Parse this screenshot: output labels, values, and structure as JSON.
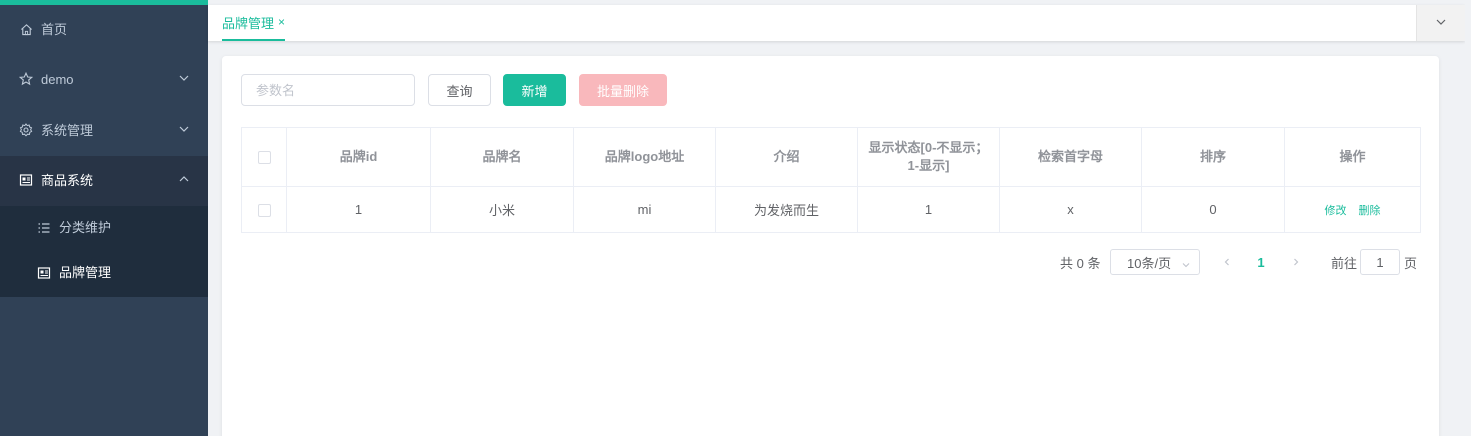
{
  "sidebar": {
    "items": [
      {
        "label": "首页",
        "icon": "home-icon"
      },
      {
        "label": "demo",
        "icon": "star-icon"
      },
      {
        "label": "系统管理",
        "icon": "gear-icon"
      },
      {
        "label": "商品系统",
        "icon": "product-icon"
      }
    ],
    "subitems": [
      {
        "label": "分类维护",
        "icon": "list-icon"
      },
      {
        "label": "品牌管理",
        "icon": "product-icon"
      }
    ]
  },
  "tabs": [
    {
      "label": "品牌管理",
      "close": "×"
    }
  ],
  "toolbar": {
    "search_placeholder": "参数名",
    "query_label": "查询",
    "add_label": "新增",
    "batch_delete_label": "批量删除"
  },
  "table": {
    "columns": [
      "品牌id",
      "品牌名",
      "品牌logo地址",
      "介绍",
      "显示状态[0-不显示；1-显示]",
      "检索首字母",
      "排序",
      "操作"
    ],
    "rows": [
      {
        "id": "1",
        "name": "小米",
        "logo": "mi",
        "intro": "为发烧而生",
        "status": "1",
        "letter": "x",
        "sort": "0",
        "edit": "修改",
        "delete": "删除"
      }
    ]
  },
  "pagination": {
    "total_text": "共 0 条",
    "page_size": "10条/页",
    "current_page": "1",
    "goto_label": "前往",
    "goto_value": "1",
    "goto_suffix": "页"
  },
  "colors": {
    "accent": "#1abc9c",
    "sidebar_bg": "#304156",
    "danger_disabled": "#f9b8bc"
  }
}
